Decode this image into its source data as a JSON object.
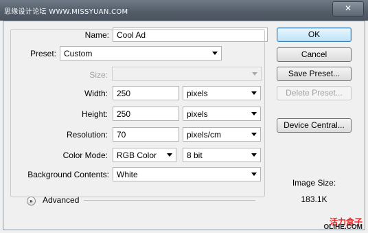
{
  "window": {
    "title": "思缘设计论坛 WWW.MISSYUAN.COM",
    "close_label": "✕"
  },
  "form": {
    "name_label": "Name:",
    "name_value": "Cool Ad",
    "preset_label": "Preset:",
    "preset_value": "Custom",
    "size_label": "Size:",
    "size_value": "",
    "width_label": "Width:",
    "width_value": "250",
    "width_unit": "pixels",
    "height_label": "Height:",
    "height_value": "250",
    "height_unit": "pixels",
    "resolution_label": "Resolution:",
    "resolution_value": "70",
    "resolution_unit": "pixels/cm",
    "color_mode_label": "Color Mode:",
    "color_mode_value": "RGB Color",
    "bit_depth_value": "8 bit",
    "background_label": "Background Contents:",
    "background_value": "White",
    "advanced_label": "Advanced"
  },
  "buttons": {
    "ok": "OK",
    "cancel": "Cancel",
    "save_preset": "Save Preset...",
    "delete_preset": "Delete Preset...",
    "device_central": "Device Central..."
  },
  "image_size": {
    "label": "Image Size:",
    "value": "183.1K"
  },
  "watermark": {
    "cn": "活力盒子",
    "en": "OLIHE.COM"
  }
}
